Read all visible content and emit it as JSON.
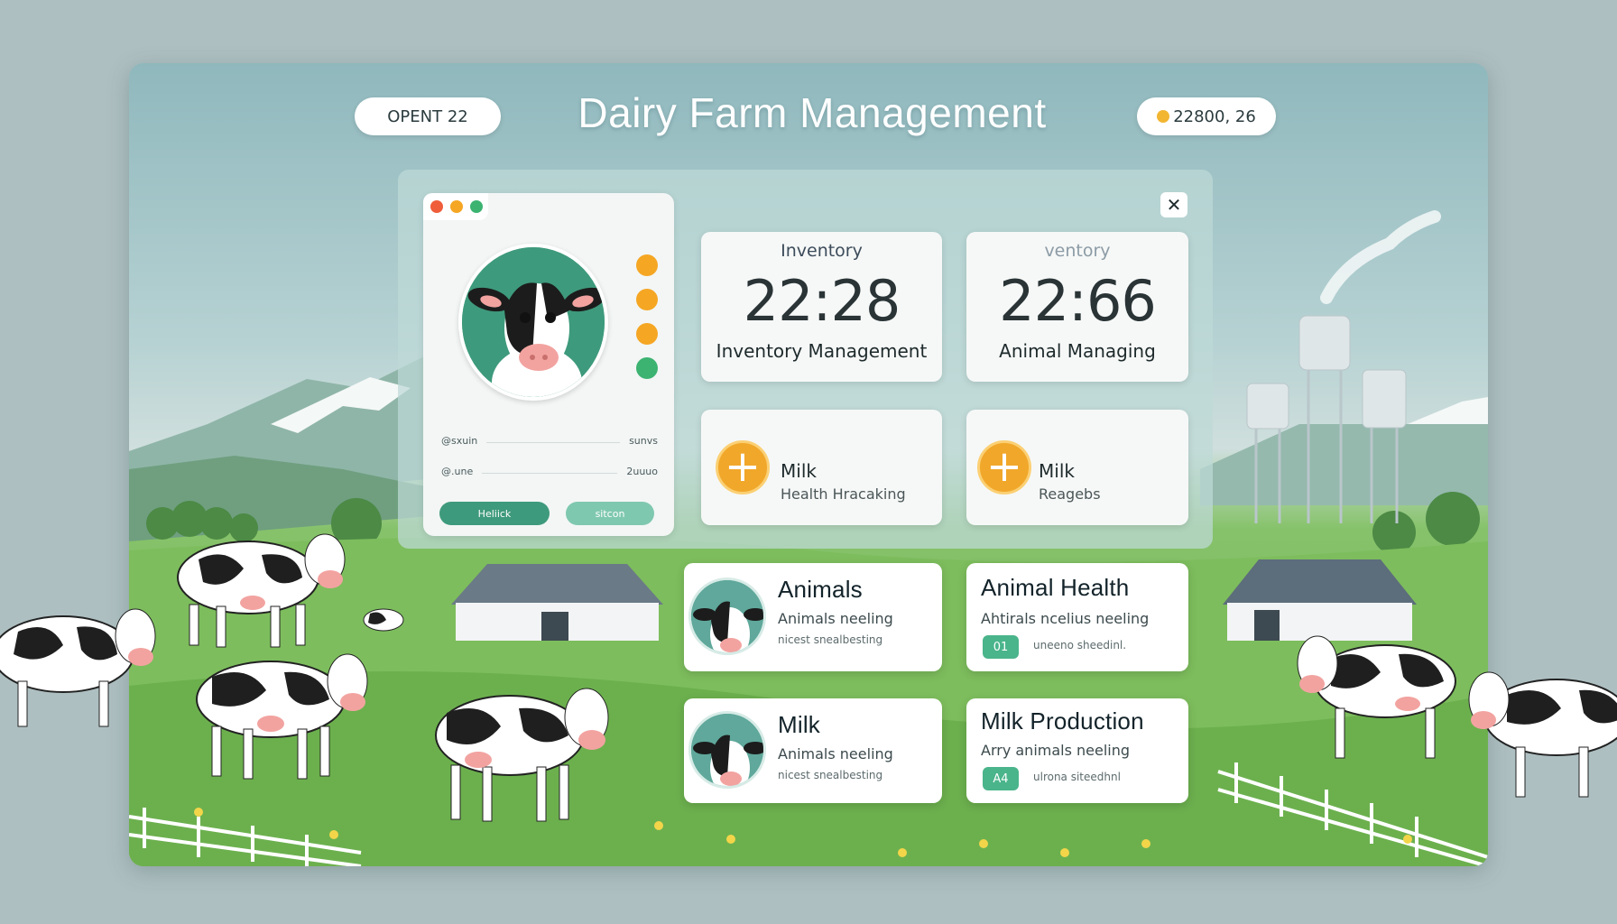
{
  "colors": {
    "accent_green": "#3e9a7c",
    "accent_orange": "#f1a72a",
    "dot_red": "#ef5d3a",
    "dot_orange": "#f5a623",
    "dot_green": "#3cb371"
  },
  "header": {
    "title": "Dairy Farm Management",
    "left_pill": "OPENT 22",
    "right_pill": "22800, 26",
    "right_pill_icon": "coin-icon"
  },
  "window": {
    "close_icon": "close-icon",
    "close_glyph": "✕"
  },
  "profile": {
    "avatar_icon": "cow-icon",
    "side_icons": [
      "orange-badge-icon",
      "orange-badge-icon",
      "orange-badge-icon",
      "green-badge-icon"
    ],
    "rows": [
      {
        "left": "@sxuin",
        "right": "sunvs"
      },
      {
        "left": "@.une",
        "right": "2uuuo"
      }
    ],
    "primary_button": "Heliick",
    "secondary_button": "sitcon"
  },
  "stats": [
    {
      "label": "Inventory",
      "value": "22:28",
      "subtitle": "Inventory Management"
    },
    {
      "label": "ventory",
      "value": "22:66",
      "subtitle": "Animal Managing"
    }
  ],
  "actions": [
    {
      "icon": "plus-icon",
      "title": "Milk",
      "subtitle": "Health Hracaking"
    },
    {
      "icon": "plus-icon",
      "title": "Milk",
      "subtitle": "Reagebs"
    }
  ],
  "cards": [
    {
      "title": "Animals",
      "subtitle": "Animals neeling",
      "detail": "nicest snealbesting"
    },
    {
      "title": "Animal Health",
      "subtitle": "Ahtirals ncelius neeling",
      "detail": "uneeno sheedinl.",
      "tag": "01"
    },
    {
      "title": "Milk",
      "subtitle": "Animals neeling",
      "detail": "nicest snealbesting"
    },
    {
      "title": "Milk Production",
      "subtitle": "Arry animals neeling",
      "detail": "ulrona siteedhnl",
      "tag": "A4"
    }
  ]
}
